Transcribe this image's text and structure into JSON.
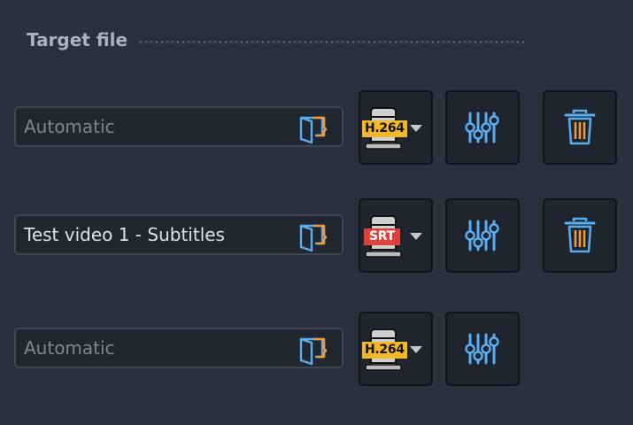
{
  "section": {
    "title": "Target file"
  },
  "rows": [
    {
      "filename": {
        "value": "",
        "placeholder": "Automatic"
      },
      "codec": {
        "label": "H.264"
      },
      "has_delete": true
    },
    {
      "filename": {
        "value": "Test video 1 - Subtitles",
        "placeholder": "Automatic"
      },
      "codec": {
        "label": "SRT"
      },
      "has_delete": true
    },
    {
      "filename": {
        "value": "",
        "placeholder": "Automatic"
      },
      "codec": {
        "label": "H.264"
      },
      "has_delete": false
    }
  ],
  "icons": {
    "folder": "folder-icon",
    "settings": "sliders-icon",
    "delete": "trash-icon",
    "dropdown": "chevron-down-icon"
  },
  "colors": {
    "background": "#29313e",
    "tile_bg": "#1e252f",
    "accent_blue": "#5aaef0",
    "accent_orange": "#f29a3a",
    "h264_badge": "#f2b82a",
    "srt_badge": "#e0403b"
  }
}
